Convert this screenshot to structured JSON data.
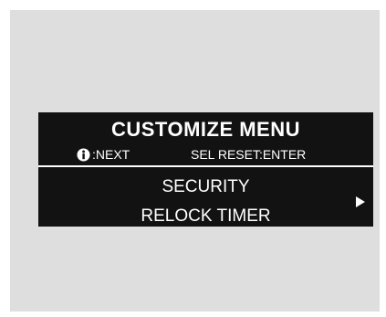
{
  "screen": {
    "title": "CUSTOMIZE MENU",
    "hint_next": ":NEXT",
    "hint_reset": "SEL RESET:ENTER",
    "lines": [
      "SECURITY",
      "RELOCK TIMER"
    ],
    "icons": {
      "info": "info-icon",
      "next_arrow": "right-arrow-icon"
    },
    "colors": {
      "display_background": "#121212",
      "text": "#ffffff",
      "frame_background": "#dedede"
    }
  }
}
